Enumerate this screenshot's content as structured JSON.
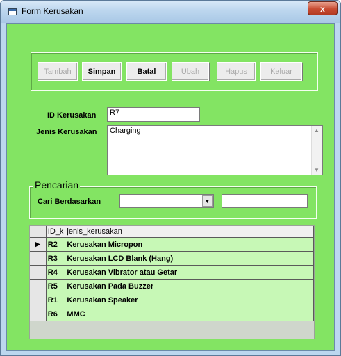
{
  "window": {
    "title": "Form Kerusakan",
    "close_label": "x"
  },
  "toolbar": {
    "tambah": "Tambah",
    "simpan": "Simpan",
    "batal": "Batal",
    "ubah": "Ubah",
    "hapus": "Hapus",
    "keluar": "Keluar"
  },
  "form": {
    "id_label": "ID Kerusakan",
    "id_value": "R7",
    "jenis_label": "Jenis Kerusakan",
    "jenis_value": "Charging"
  },
  "search": {
    "legend": "Pencarian",
    "label": "Cari Berdasarkan",
    "combo_value": "",
    "text_value": ""
  },
  "grid": {
    "headers": [
      "ID_k",
      "jenis_kerusakan"
    ],
    "rows": [
      {
        "id": "R2",
        "jenis": "Kerusakan Micropon"
      },
      {
        "id": "R3",
        "jenis": "Kerusakan LCD Blank (Hang)"
      },
      {
        "id": "R4",
        "jenis": "Kerusakan Vibrator atau Getar"
      },
      {
        "id": "R5",
        "jenis": "Kerusakan Pada Buzzer"
      },
      {
        "id": "R1",
        "jenis": "Kerusakan Speaker"
      },
      {
        "id": "R6",
        "jenis": "MMC"
      }
    ]
  },
  "colors": {
    "form_bg": "#83e463",
    "row_bg": "#c7f8b6"
  }
}
